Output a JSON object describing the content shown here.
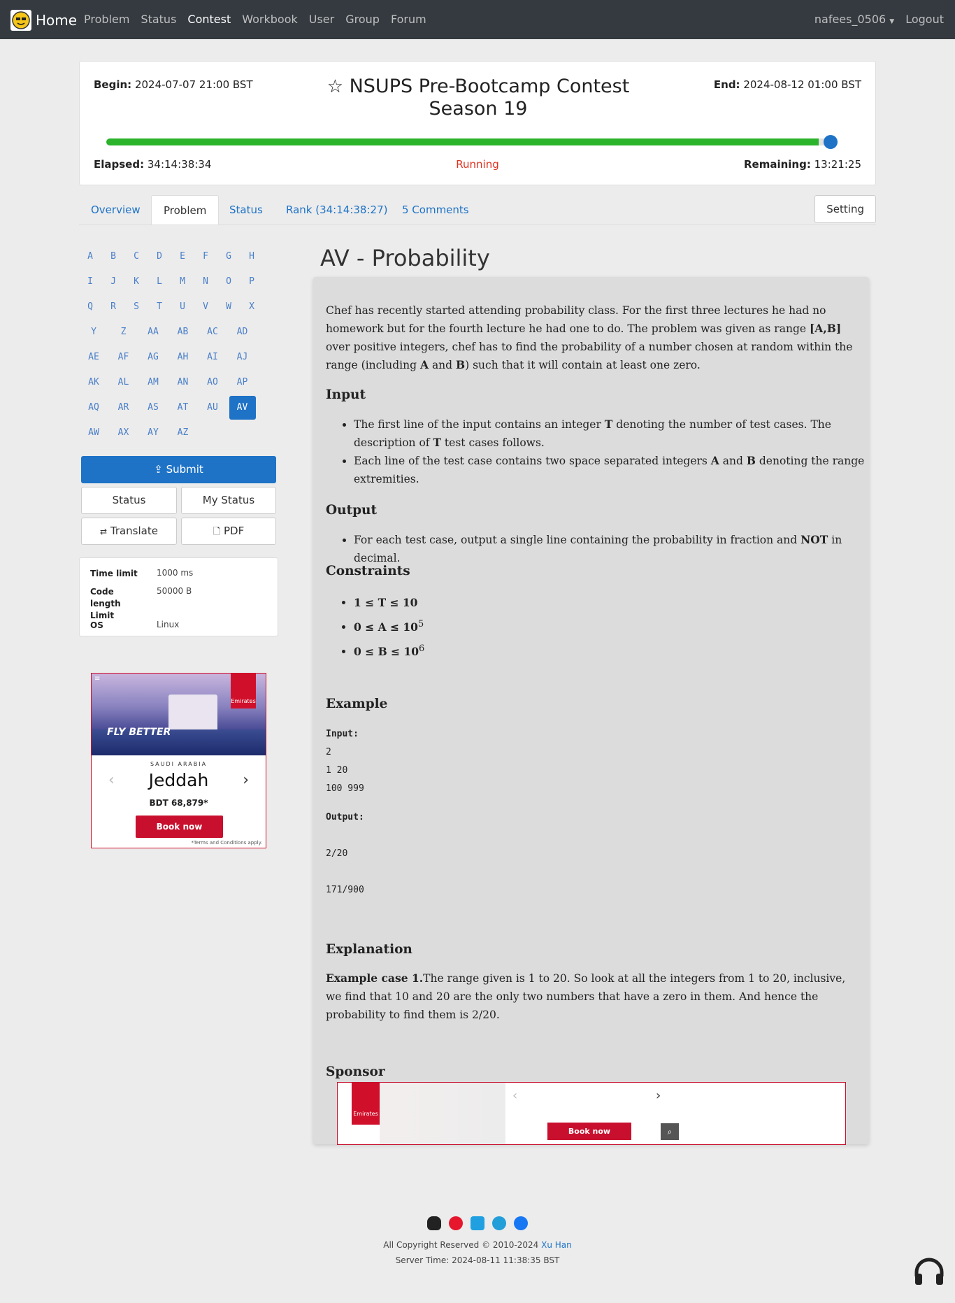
{
  "navbar": {
    "home": "Home",
    "items": [
      "Problem",
      "Status",
      "Contest",
      "Workbook",
      "User",
      "Group",
      "Forum"
    ],
    "active": "Contest",
    "user": "nafees_0506",
    "logout": "Logout"
  },
  "contest": {
    "begin_label": "Begin:",
    "begin_value": "2024-07-07 21:00 BST",
    "end_label": "End:",
    "end_value": "2024-08-12 01:00 BST",
    "title": "NSUPS Pre-Bootcamp Contest Season 19",
    "elapsed_label": "Elapsed:",
    "elapsed_value": "34:14:38:34",
    "status": "Running",
    "remaining_label": "Remaining:",
    "remaining_value": "13:21:25",
    "progress_fraction": 0.98
  },
  "tabs": {
    "overview": "Overview",
    "problem": "Problem",
    "status": "Status",
    "rank": "Rank (34:14:38:27)",
    "comments": "5 Comments",
    "setting": "Setting"
  },
  "problems": [
    "A",
    "B",
    "C",
    "D",
    "E",
    "F",
    "G",
    "H",
    "I",
    "J",
    "K",
    "L",
    "M",
    "N",
    "O",
    "P",
    "Q",
    "R",
    "S",
    "T",
    "U",
    "V",
    "W",
    "X",
    "Y",
    "Z",
    "AA",
    "AB",
    "AC",
    "AD",
    "AE",
    "AF",
    "AG",
    "AH",
    "AI",
    "AJ",
    "AK",
    "AL",
    "AM",
    "AN",
    "AO",
    "AP",
    "AQ",
    "AR",
    "AS",
    "AT",
    "AU",
    "AV",
    "AW",
    "AX",
    "AY",
    "AZ"
  ],
  "active_problem": "AV",
  "side": {
    "submit": "Submit",
    "status": "Status",
    "my_status": "My Status",
    "translate": "Translate",
    "pdf": "PDF",
    "time_limit_label": "Time limit",
    "time_limit_value": "1000 ms",
    "code_length_label": "Code length Limit",
    "code_length_value": "50000 B",
    "os_label": "OS",
    "os_value": "Linux"
  },
  "ad": {
    "fly_better": "FLY BETTER",
    "brand": "Emirates",
    "country": "SAUDI ARABIA",
    "city": "Jeddah",
    "price": "BDT 68,879*",
    "book": "Book now",
    "terms": "*Terms and Conditions apply."
  },
  "problem": {
    "heading": "AV - Probability",
    "statement_1": "Chef has recently started attending probability class. For the first three lectures he had no homework but for the fourth lecture he had one to do. The problem was given as range ",
    "statement_range": "[A,B]",
    "statement_2": " over positive integers, chef has to find the probability of a number chosen at random within the range (including ",
    "statement_a": "A",
    "statement_3": " and ",
    "statement_b": "B",
    "statement_4": ") such that it will contain at least one zero.",
    "input_title": "Input",
    "input_1a": "The first line of the input contains an integer ",
    "input_1t": "T",
    "input_1b": " denoting the number of test cases. The description of ",
    "input_1t2": "T",
    "input_1c": " test cases follows.",
    "input_2a": "Each line of the test case contains two space separated integers ",
    "input_2A": "A",
    "input_2and": " and ",
    "input_2B": "B",
    "input_2b": " denoting the range extremities.",
    "output_title": "Output",
    "output_1a": "For each test case, output a single line containing the probability in fraction and ",
    "output_not": "NOT",
    "output_1b": " in decimal.",
    "constraints_title": "Constraints",
    "c1": "1 ≤ T ≤ 10",
    "c2": "0 ≤ A ≤ 10",
    "c2_exp": "5",
    "c3": "0 ≤ B ≤ 10",
    "c3_exp": "6",
    "example_title": "Example",
    "ex_input_label": "Input:",
    "ex_input_lines": [
      "2",
      "1 20",
      "100 999"
    ],
    "ex_output_label": "Output:",
    "ex_output_lines": [
      "2/20",
      "171/900"
    ],
    "explanation_title": "Explanation",
    "expl_bold": "Example case 1.",
    "expl_text": "The range given is 1 to 20. So look at all the integers from 1 to 20, inclusive, we find that 10 and 20 are the only two numbers that have a zero in them. And hence the probability to find them is 2/20.",
    "sponsor_title": "Sponsor",
    "sponsor_brand": "Emirates",
    "sponsor_book": "Book now"
  },
  "footer": {
    "copyright_text": "All Copyright Reserved © 2010-2024 ",
    "author": "Xu Han",
    "server_time": "Server Time: 2024-08-11 11:38:35 BST"
  },
  "colors": {
    "navbar": "#343a40",
    "link": "#1e73c7",
    "progress": "#2bb32b",
    "running": "#e0301e",
    "ad_red": "#c8102e"
  }
}
